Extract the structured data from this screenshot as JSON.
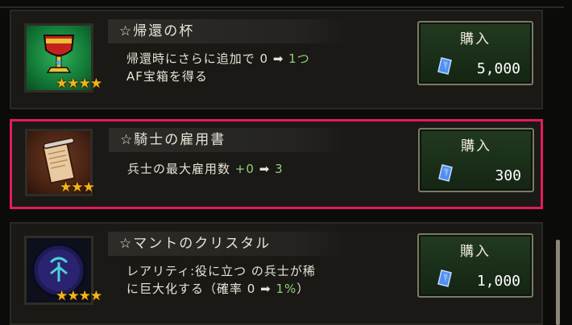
{
  "items": [
    {
      "title": "☆帰還の杯",
      "desc_line1": "帰還時にさらに追加で",
      "desc_from": "0",
      "desc_arrow": "➡",
      "desc_to": "1つ",
      "desc_line2": "AF宝箱を得る",
      "stars": "★★★★",
      "buy_label": "購入",
      "price": "5,000",
      "icon": "goblet-icon"
    },
    {
      "title": "☆騎士の雇用書",
      "desc_line1": "兵士の最大雇用数",
      "desc_from": "+0",
      "desc_arrow": "➡",
      "desc_to": "3",
      "stars": "★★★",
      "buy_label": "購入",
      "price": "300",
      "icon": "scroll-icon",
      "selected": true
    },
    {
      "title": "☆マントのクリスタル",
      "desc_line1": "レアリティ:役に立つ の兵士が稀",
      "desc_line2_prefix": "に巨大化する（確率",
      "desc_from": "0",
      "desc_arrow": "➡",
      "desc_to": "1%",
      "desc_suffix": "）",
      "stars": "★★★★",
      "buy_label": "購入",
      "price": "1,000",
      "icon": "crystal-orb-icon"
    }
  ],
  "colors": {
    "selected_border": "#e31b5c",
    "value_green": "#8fd17b",
    "star": "#f4b51a"
  },
  "currency_icon": "blue-gem-icon"
}
